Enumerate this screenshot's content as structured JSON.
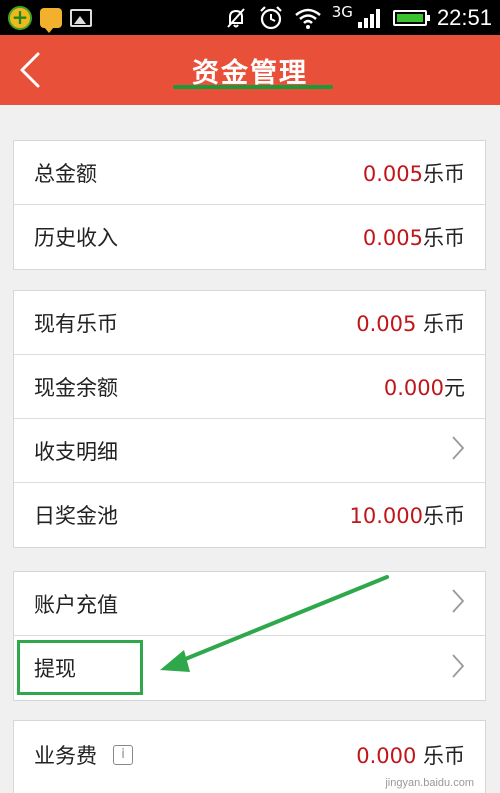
{
  "status_bar": {
    "network_label": "3G",
    "time": "22:51",
    "battery_level": 1.0,
    "icons": [
      "app-plus-icon",
      "chat-bubble-icon",
      "gallery-icon",
      "bell-off-icon",
      "alarm-clock-icon",
      "wifi-icon",
      "signal-icon",
      "battery-icon"
    ]
  },
  "header": {
    "title": "资金管理",
    "back_icon": "chevron-left-icon",
    "bg_color": "#e8503a"
  },
  "group1": {
    "rows": [
      {
        "label": "总金额",
        "amount": "0.005",
        "unit": "乐币"
      },
      {
        "label": "历史收入",
        "amount": "0.005",
        "unit": "乐币"
      }
    ]
  },
  "group2": {
    "rows": [
      {
        "label": "现有乐币",
        "amount": "0.005 ",
        "unit": "乐币"
      },
      {
        "label": "现金余额",
        "amount": "0.000",
        "unit": "元"
      },
      {
        "label": "收支明细"
      },
      {
        "label": "日奖金池",
        "amount": "10.000",
        "unit": "乐币"
      }
    ]
  },
  "group3": {
    "rows": [
      {
        "label": "账户充值"
      },
      {
        "label": "提现"
      }
    ]
  },
  "group4": {
    "rows": [
      {
        "label": "业务费",
        "info_icon": "i",
        "amount": "0.000 ",
        "unit": "乐币"
      }
    ]
  },
  "watermark": "jingyan.baidu.com",
  "colors": {
    "accent": "#e8503a",
    "amount": "#c0161b",
    "highlight": "#2ea84b"
  }
}
